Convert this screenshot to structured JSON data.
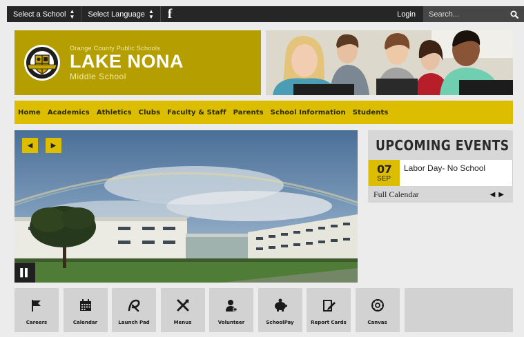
{
  "topbar": {
    "school_select": "Select a School",
    "language_select": "Select Language",
    "facebook": "f",
    "login": "Login",
    "search_placeholder": "Search..."
  },
  "header": {
    "district": "Orange County Public Schools",
    "school_name": "LAKE NONA",
    "school_type": "Middle School"
  },
  "nav": {
    "items": [
      "Home",
      "Academics",
      "Athletics",
      "Clubs",
      "Faculty & Staff",
      "Parents",
      "School Information",
      "Students"
    ]
  },
  "events": {
    "title": "UPCOMING EVENTS",
    "items": [
      {
        "day": "07",
        "month": "SEP",
        "name": "Labor Day- No School"
      }
    ],
    "full_calendar": "Full Calendar"
  },
  "quick_links": [
    {
      "label": "Careers",
      "icon": "flag-icon"
    },
    {
      "label": "Calendar",
      "icon": "calendar-icon"
    },
    {
      "label": "Launch Pad",
      "icon": "launchpad-icon"
    },
    {
      "label": "Menus",
      "icon": "utensils-icon"
    },
    {
      "label": "Volunteer",
      "icon": "volunteer-icon"
    },
    {
      "label": "SchoolPay",
      "icon": "piggy-bank-icon"
    },
    {
      "label": "Report Cards",
      "icon": "report-card-icon"
    },
    {
      "label": "Canvas",
      "icon": "canvas-icon"
    }
  ],
  "colors": {
    "gold_dark": "#b59f00",
    "gold": "#dcbd00",
    "topbar": "#262626",
    "tile": "#d2d2d2"
  }
}
